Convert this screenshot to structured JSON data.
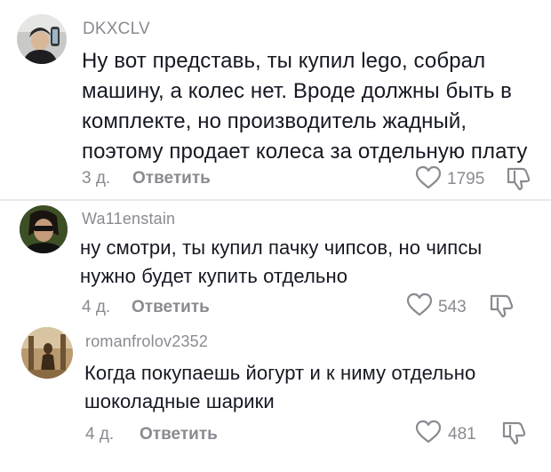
{
  "comments": [
    {
      "username": "DKXCLV",
      "text": "Ну вот представь, ты купил lego, собрал машину, а колес нет. Вроде должны быть в комплекте, но производитель жадный, поэтому продает колеса за отдельную плату",
      "age": "3 д.",
      "reply_label": "Ответить",
      "likes": "1795"
    },
    {
      "username": "Wa11enstain",
      "text": "ну смотри, ты купил пачку чипсов, но чипсы нужно будет купить отдельно",
      "age": "4 д.",
      "reply_label": "Ответить",
      "likes": "543"
    },
    {
      "username": "romanfrolov2352",
      "text": "Когда покупаешь йогурт и к ниму отдельно шоколадные шарики",
      "age": "4 д.",
      "reply_label": "Ответить",
      "likes": "481"
    }
  ],
  "icons": {
    "like": "heart-outline-icon",
    "dislike": "thumbs-down-outline-icon"
  },
  "colors": {
    "text": "#161823",
    "muted": "#8a8b91",
    "divider": "#e9e9eb",
    "background": "#ffffff"
  }
}
